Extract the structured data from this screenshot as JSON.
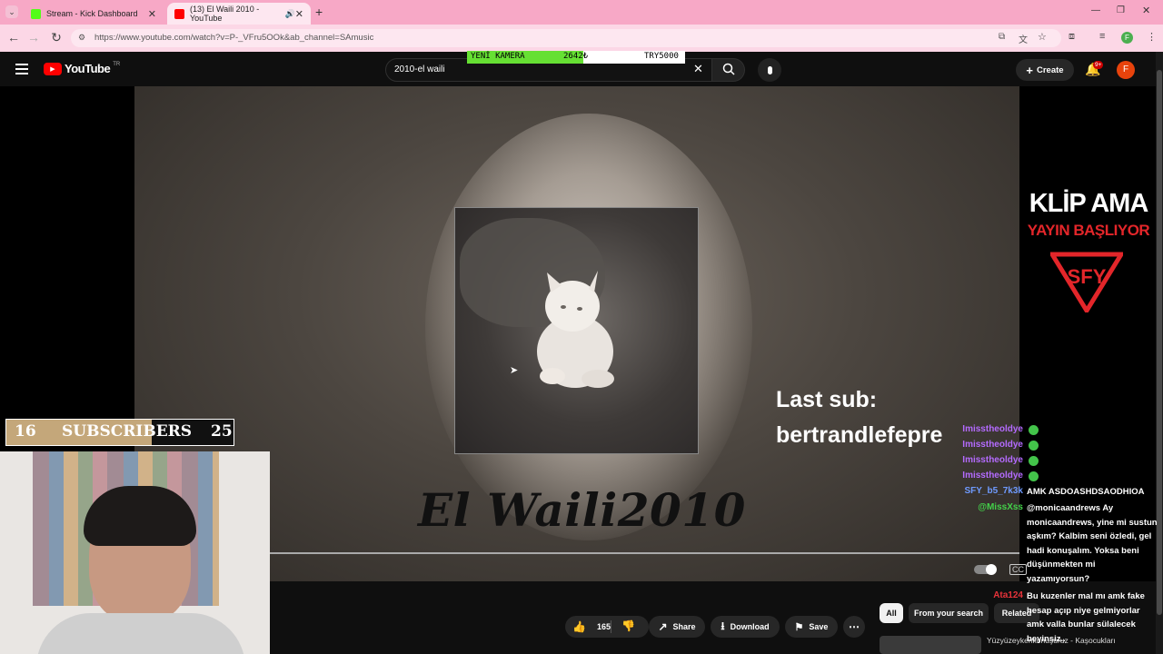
{
  "browser": {
    "tabs": [
      {
        "title": "Stream - Kick Dashboard"
      },
      {
        "title": "(13) El Waili 2010 - YouTube"
      }
    ],
    "new_tab": "+",
    "url": "https://www.youtube.com/watch?v=P-_VFru5OOk&ab_channel=SAmusic"
  },
  "youtube": {
    "logo": "YouTube",
    "region": "TR",
    "search_value": "2010-el waili",
    "create_label": "Create",
    "notif_badge": "9+",
    "avatar_letter": "F"
  },
  "stream_overlay": {
    "ticker": {
      "label": "YENİ KAMERA",
      "amount": "2642₺",
      "goal": "TRY5000"
    },
    "sub_goal": {
      "current": "16",
      "label": "SUBSCRIBERS",
      "target": "25",
      "progress": 0.64
    },
    "banner_title": "KLİP AMA",
    "banner_subtitle": "YAYIN BAŞLIYOR",
    "logo_text": "SFY",
    "last_sub_label": "Last sub:",
    "last_sub_name": "bertrandlefepre"
  },
  "video": {
    "title_art": "El Waili2010"
  },
  "actions": {
    "likes": "165",
    "share": "Share",
    "download": "Download",
    "save": "Save"
  },
  "chips": [
    "All",
    "From your search",
    "Related"
  ],
  "chat": [
    {
      "user": "Imisstheoldye",
      "msg": ""
    },
    {
      "user": "Imisstheoldye",
      "msg": ""
    },
    {
      "user": "Imisstheoldye",
      "msg": ""
    },
    {
      "user": "Imisstheoldye",
      "msg": ""
    },
    {
      "user": "SFY_b5_7k3k",
      "msg": "AMK ASDOASHDSAODHIOA"
    },
    {
      "user": "@MissXss",
      "msg": "@monicaandrews Ay monicaandrews, yine mi sustun aşkım? Kalbim seni özledi, gel hadi konuşalım. Yoksa beni düşünmekten mi yazamıyorsun?"
    },
    {
      "user": "Ata124",
      "msg": "Bu kuzenler mal mı amk fake hesap açıp niye gelmiyorlar amk valla bunlar sülalecek beyinsiz.."
    }
  ],
  "recommend_snippet": "Yüzyüzeykenkonuşuruz - Kaşocukları",
  "colors": {
    "tabstrip": "#f7a8c6",
    "toolbar": "#fcd7e6",
    "yt_red": "#ff0000",
    "overlay_red": "#e3262a",
    "chat_purple": "#b46bff",
    "chat_blue": "#6f9bff",
    "chat_green": "#43d24a",
    "chat_red": "#e8333a"
  }
}
